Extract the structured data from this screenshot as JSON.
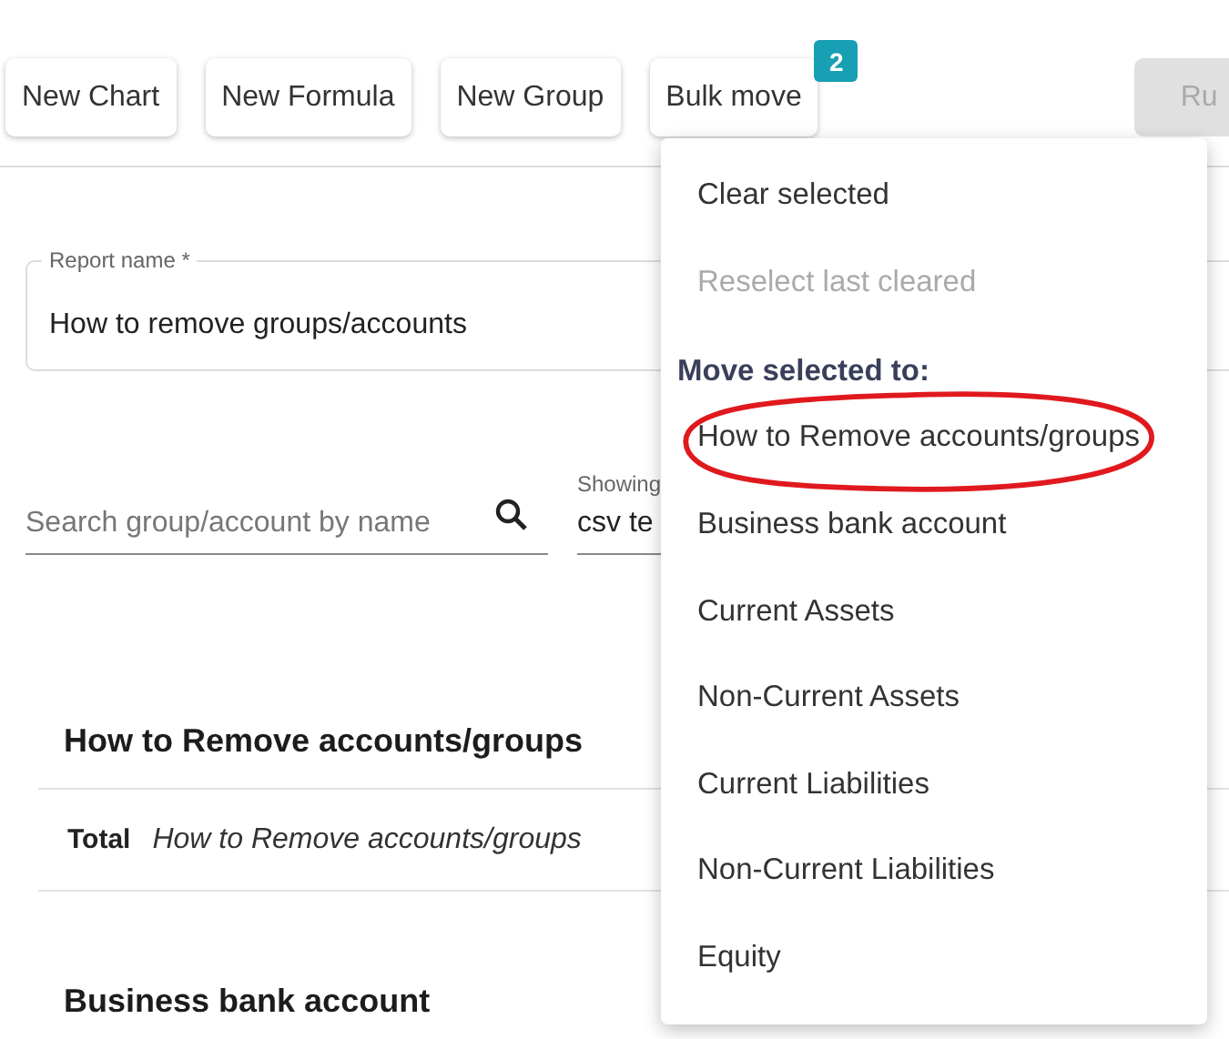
{
  "toolbar": {
    "buttons": [
      {
        "label": "New Chart",
        "disabled": false
      },
      {
        "label": "New Formula",
        "disabled": false
      },
      {
        "label": "New Group",
        "disabled": false
      },
      {
        "label": "Bulk move",
        "disabled": false,
        "badge": "2"
      },
      {
        "label": "Ru",
        "disabled": true
      }
    ]
  },
  "report_name": {
    "label": "Report name *",
    "value": "How to remove groups/accounts"
  },
  "search": {
    "placeholder": "Search group/account by name"
  },
  "showing": {
    "label": "Showing",
    "value": "csv te"
  },
  "sections": [
    {
      "title": "How to Remove accounts/groups",
      "total_label": "Total",
      "total_name": "How to Remove accounts/groups"
    },
    {
      "title": "Business bank account"
    }
  ],
  "menu": {
    "items": [
      {
        "kind": "action",
        "label": "Clear selected",
        "disabled": false
      },
      {
        "kind": "action",
        "label": "Reselect last cleared",
        "disabled": true
      },
      {
        "kind": "header",
        "label": "Move selected to:"
      },
      {
        "kind": "action",
        "label": "How to Remove accounts/groups",
        "disabled": false,
        "circled": true
      },
      {
        "kind": "action",
        "label": "Business bank account",
        "disabled": false,
        "circled": false
      },
      {
        "kind": "action",
        "label": "Current Assets",
        "disabled": false,
        "circled": false
      },
      {
        "kind": "action",
        "label": "Non-Current Assets",
        "disabled": false,
        "circled": false
      },
      {
        "kind": "action",
        "label": "Current Liabilities",
        "disabled": false,
        "circled": false
      },
      {
        "kind": "action",
        "label": "Non-Current Liabilities",
        "disabled": false,
        "circled": false
      },
      {
        "kind": "action",
        "label": "Equity",
        "disabled": false,
        "circled": false
      }
    ]
  }
}
